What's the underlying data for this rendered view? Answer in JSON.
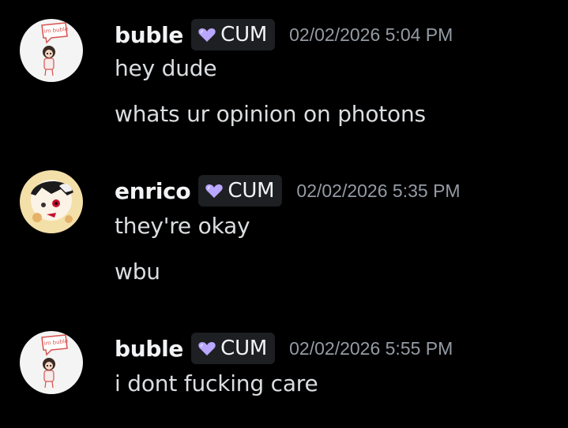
{
  "messages": [
    {
      "author": "buble",
      "tag": "CUM",
      "timestamp": "02/02/2026 5:04 PM",
      "avatar_icon": "buble-avatar-icon",
      "avatar_bubble_text": "im buble",
      "lines": [
        "hey dude",
        "whats ur opinion on photons"
      ]
    },
    {
      "author": "enrico",
      "tag": "CUM",
      "timestamp": "02/02/2026 5:35 PM",
      "avatar_icon": "enrico-avatar-icon",
      "lines": [
        "they're okay",
        "wbu"
      ]
    },
    {
      "author": "buble",
      "tag": "CUM",
      "timestamp": "02/02/2026 5:55 PM",
      "avatar_icon": "buble-avatar-icon",
      "avatar_bubble_text": "im buble",
      "lines": [
        "i dont fucking care"
      ]
    }
  ],
  "tag_icon": "purple-heart-icon",
  "colors": {
    "background": "#000000",
    "username": "#f2f3f5",
    "message_text": "#dbdee1",
    "timestamp": "#949ba4",
    "tag_background": "#1e1f22",
    "tag_heart": "#b9a6ff"
  }
}
